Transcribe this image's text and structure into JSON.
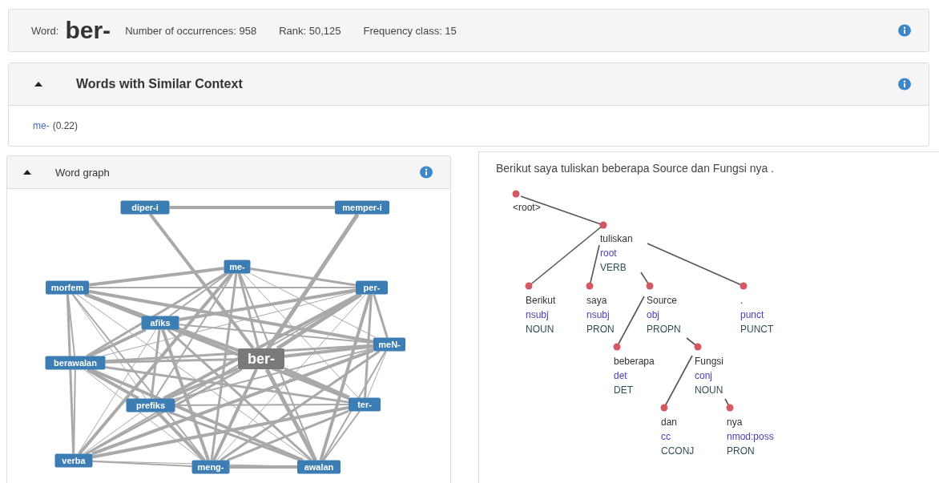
{
  "word_info": {
    "label": "Word:",
    "word": "ber-",
    "stats": [
      "Number of occurrences: 958",
      "Rank: 50,125",
      "Frequency class: 15"
    ]
  },
  "similar_context": {
    "title": "Words with Similar Context",
    "expanded": true,
    "items": [
      {
        "word": "me-",
        "score": "(0.22)"
      }
    ]
  },
  "word_graph": {
    "title": "Word graph",
    "expanded": true,
    "nodes": [
      {
        "label": "diper-i",
        "kind": "word"
      },
      {
        "label": "memper-i",
        "kind": "word"
      },
      {
        "label": "me-",
        "kind": "word"
      },
      {
        "label": "morfem",
        "kind": "word"
      },
      {
        "label": "per-",
        "kind": "word"
      },
      {
        "label": "afiks",
        "kind": "word"
      },
      {
        "label": "meN-",
        "kind": "word"
      },
      {
        "label": "ber-",
        "kind": "center"
      },
      {
        "label": "berawalan",
        "kind": "word"
      },
      {
        "label": "prefiks",
        "kind": "word"
      },
      {
        "label": "ter-",
        "kind": "word"
      },
      {
        "label": "verba",
        "kind": "word"
      },
      {
        "label": "meng-",
        "kind": "word"
      },
      {
        "label": "awalan",
        "kind": "word"
      }
    ]
  },
  "dependency_tree": {
    "sentence": "Berikut saya tuliskan beberapa Source dan Fungsi nya .",
    "root": {
      "word": "<root>",
      "children": [
        {
          "word": "tuliskan",
          "deprel": "root",
          "pos": "VERB",
          "children": [
            {
              "word": "Berikut",
              "deprel": "nsubj",
              "pos": "NOUN"
            },
            {
              "word": "saya",
              "deprel": "nsubj",
              "pos": "PRON"
            },
            {
              "word": "Source",
              "deprel": "obj",
              "pos": "PROPN",
              "children": [
                {
                  "word": "beberapa",
                  "deprel": "det",
                  "pos": "DET"
                },
                {
                  "word": "Fungsi",
                  "deprel": "conj",
                  "pos": "NOUN",
                  "children": [
                    {
                      "word": "dan",
                      "deprel": "cc",
                      "pos": "CCONJ"
                    },
                    {
                      "word": "nya",
                      "deprel": "nmod:poss",
                      "pos": "PRON"
                    }
                  ]
                }
              ]
            },
            {
              "word": ".",
              "deprel": "punct",
              "pos": "PUNCT"
            }
          ]
        }
      ]
    }
  }
}
